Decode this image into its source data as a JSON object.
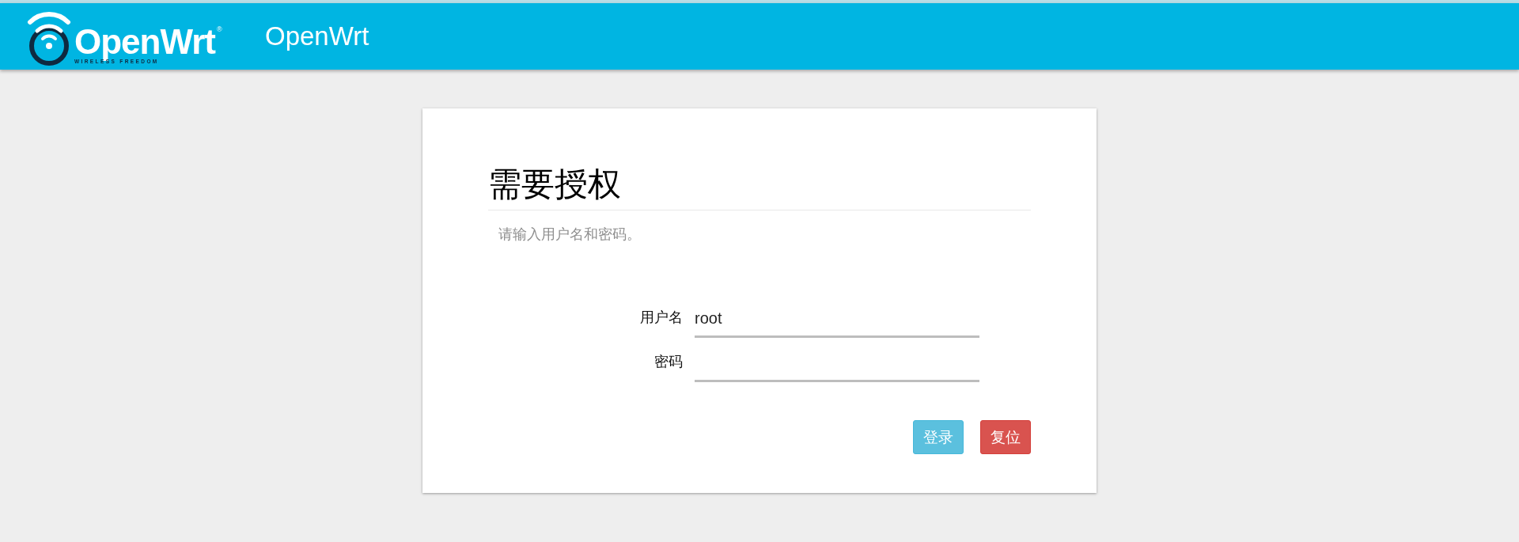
{
  "header": {
    "logo": {
      "wordmark": "OpenWrt",
      "registered": "®",
      "tagline": "WIRELESS FREEDOM"
    },
    "brand": "OpenWrt"
  },
  "login": {
    "title": "需要授权",
    "description": "请输入用户名和密码。",
    "fields": [
      {
        "label": "用户名",
        "value": "root"
      },
      {
        "label": "密码"
      }
    ],
    "buttons": [
      {
        "label": "登录",
        "kind": "primary"
      },
      {
        "label": "复位",
        "kind": "reset"
      }
    ]
  }
}
